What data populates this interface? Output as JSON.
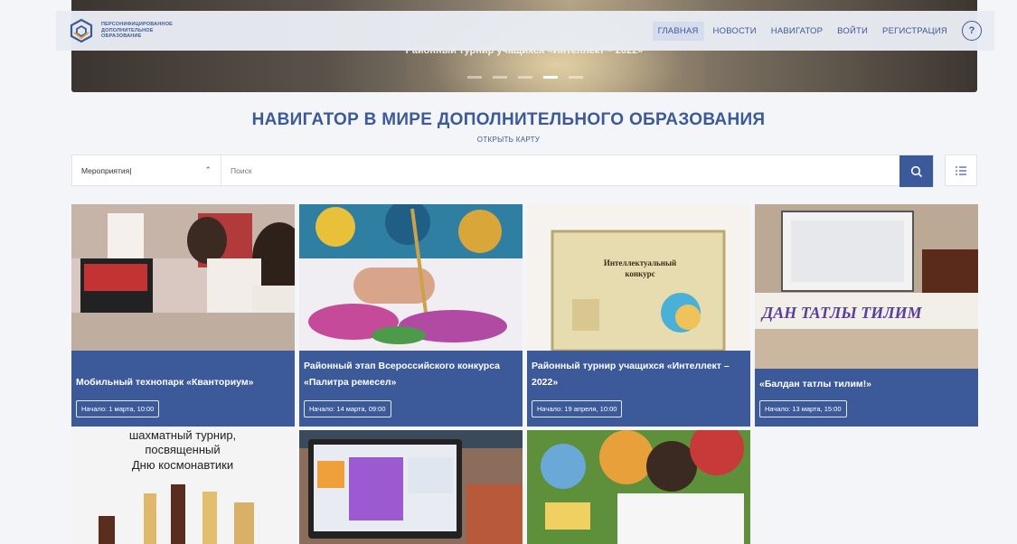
{
  "banner": {
    "caption": "Районный турнир учащихся «Интеллект – 2022»"
  },
  "header": {
    "logo_lines": [
      "ПЕРСОНИФИЦИРОВАННОЕ",
      "ДОПОЛНИТЕЛЬНОЕ",
      "ОБРАЗОВАНИЕ"
    ],
    "nav": [
      "ГЛАВНАЯ",
      "НОВОСТИ",
      "НАВИГАТОР",
      "ВОЙТИ",
      "РЕГИСТРАЦИЯ"
    ],
    "help": "?"
  },
  "page": {
    "title": "НАВИГАТОР В МИРЕ ДОПОЛНИТЕЛЬНОГО ОБРАЗОВАНИЯ",
    "map_link": "ОТКРЫТЬ КАРТУ"
  },
  "search": {
    "category": "Мероприятия",
    "placeholder": "Поиск"
  },
  "cards": [
    {
      "title": "Мобильный технопарк «Кванториум»",
      "date": "Начало: 1 марта, 10:00"
    },
    {
      "title": "Районный этап Всероссийского конкурса «Палитра ремесел»",
      "date": "Начало: 14 марта, 09:00"
    },
    {
      "title": "Районный турнир учащихся «Интеллект – 2022»",
      "date": "Начало: 19 апреля, 10:00"
    },
    {
      "title": "«Балдан татлы тилим!»",
      "date": "Начало: 13 марта, 15:00"
    }
  ],
  "card_images": {
    "intellect_sign": [
      "Интеллектуальный",
      "конкурс"
    ],
    "board_letters": "ДАН ТАТЛЫ ТИЛИМ",
    "chess_poster": [
      "шахматный турнир,",
      "посвященный",
      "Дню космонавтики"
    ]
  },
  "colors": {
    "brand": "#3c5a99",
    "background": "#f4f5f8"
  }
}
